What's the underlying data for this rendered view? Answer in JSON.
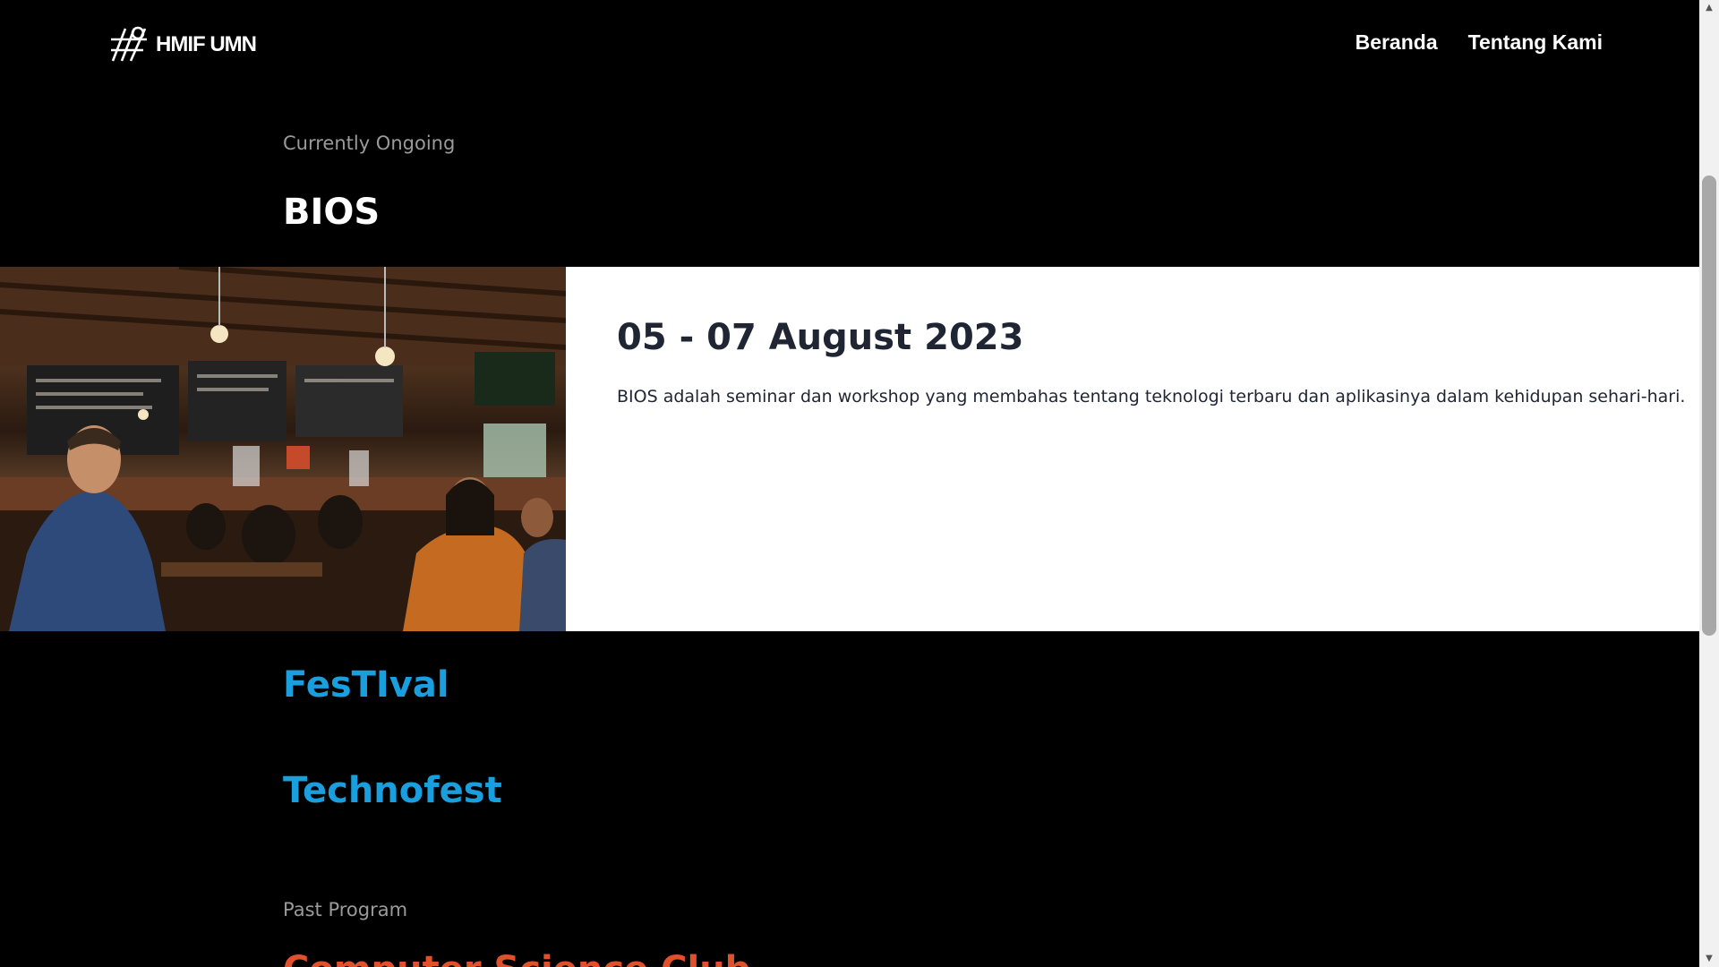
{
  "brand": {
    "name": "HMIF UMN"
  },
  "nav": {
    "items": [
      "Beranda",
      "Tentang Kami"
    ]
  },
  "ongoing": {
    "label": "Currently Ongoing",
    "featured": {
      "title": "BIOS",
      "date": "05 - 07 August 2023",
      "description": "BIOS adalah seminar dan workshop yang membahas tentang teknologi terbaru dan aplikasinya dalam kehidupan sehari-hari."
    },
    "others": [
      "FesTIval",
      "Technofest"
    ]
  },
  "past": {
    "label": "Past Program",
    "first_title": "Computer Science Club"
  },
  "colors": {
    "background": "#000000",
    "link_blue": "#1a9fde",
    "past_red": "#e0512b",
    "text_dark": "#1f2533"
  }
}
